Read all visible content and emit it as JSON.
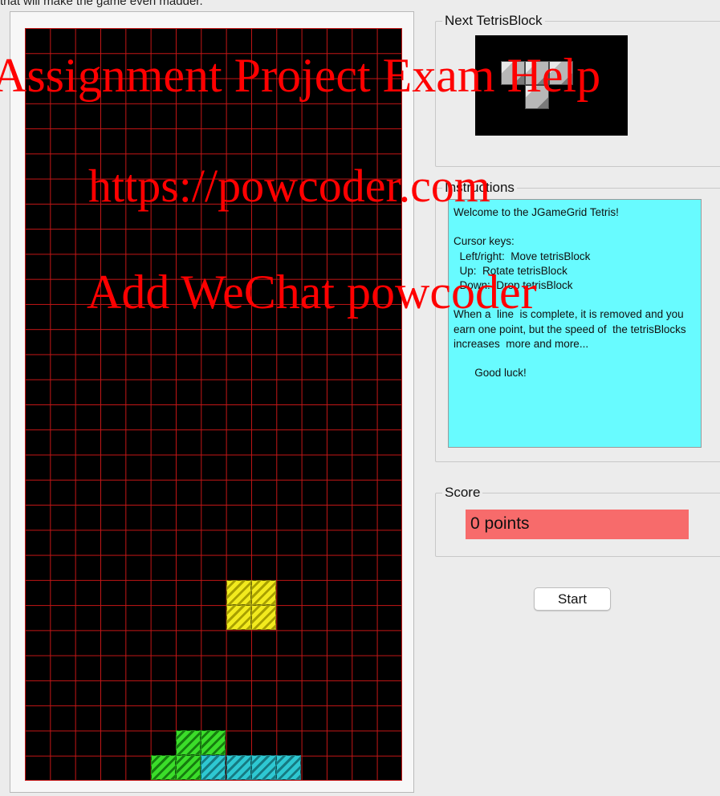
{
  "caption": "that will make the game even madder.",
  "next_block": {
    "label": "Next TetrisBlock"
  },
  "instructions": {
    "label": "Instructions",
    "text": "Welcome to the JGameGrid Tetris!\n\nCursor keys:\n  Left/right:  Move tetrisBlock\n  Up:  Rotate tetrisBlock\n  Down:  Drop tetrisBlock\n\nWhen a  line  is complete, it is removed and you earn one point, but the speed of  the tetrisBlocks  increases  more and more...\n\n       Good luck!"
  },
  "score": {
    "label": "Score",
    "value": "0 points"
  },
  "controls": {
    "start_label": "Start"
  },
  "board": {
    "columns": 15,
    "rows": 30
  },
  "watermark": {
    "line1": "Assignment Project Exam Help",
    "line2": "https://powcoder.com",
    "line3": "Add WeChat powcoder"
  },
  "colors": {
    "board_background": "#000000",
    "grid_lines": "#c41616",
    "instructions_background": "#68fbff",
    "score_background": "#f76b6b",
    "watermark": "#ff0000"
  }
}
